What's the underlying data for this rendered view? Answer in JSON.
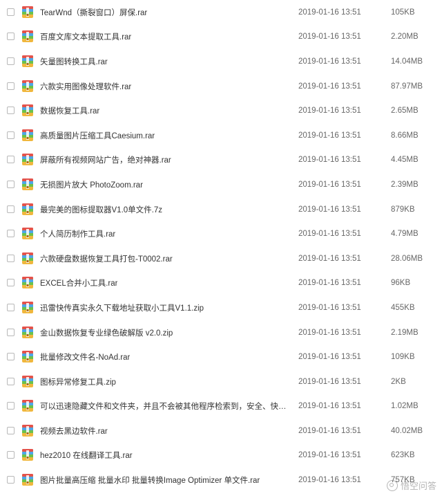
{
  "files": [
    {
      "name": "TearWnd（撕裂窗口）屏保.rar",
      "date": "2019-01-16 13:51",
      "size": "105KB"
    },
    {
      "name": "百度文库文本提取工具.rar",
      "date": "2019-01-16 13:51",
      "size": "2.20MB"
    },
    {
      "name": "矢量图转换工具.rar",
      "date": "2019-01-16 13:51",
      "size": "14.04MB"
    },
    {
      "name": "六款实用图像处理软件.rar",
      "date": "2019-01-16 13:51",
      "size": "87.97MB"
    },
    {
      "name": "数据恢复工具.rar",
      "date": "2019-01-16 13:51",
      "size": "2.65MB"
    },
    {
      "name": "高质量图片压缩工具Caesium.rar",
      "date": "2019-01-16 13:51",
      "size": "8.66MB"
    },
    {
      "name": "屏蔽所有视频网站广告，绝对神器.rar",
      "date": "2019-01-16 13:51",
      "size": "4.45MB"
    },
    {
      "name": "无损图片放大 PhotoZoom.rar",
      "date": "2019-01-16 13:51",
      "size": "2.39MB"
    },
    {
      "name": "最完美的图标提取器V1.0单文件.7z",
      "date": "2019-01-16 13:51",
      "size": "879KB"
    },
    {
      "name": "个人简历制作工具.rar",
      "date": "2019-01-16 13:51",
      "size": "4.79MB"
    },
    {
      "name": "六款硬盘数据恢复工具打包-T0002.rar",
      "date": "2019-01-16 13:51",
      "size": "28.06MB"
    },
    {
      "name": "EXCEL合并小工具.rar",
      "date": "2019-01-16 13:51",
      "size": "96KB"
    },
    {
      "name": "迅雷快传真实永久下载地址获取小工具V1.1.zip",
      "date": "2019-01-16 13:51",
      "size": "455KB"
    },
    {
      "name": "金山数据恢复专业绿色破解版 v2.0.zip",
      "date": "2019-01-16 13:51",
      "size": "2.19MB"
    },
    {
      "name": "批量修改文件名-NoAd.rar",
      "date": "2019-01-16 13:51",
      "size": "109KB"
    },
    {
      "name": "图标异常修复工具.zip",
      "date": "2019-01-16 13:51",
      "size": "2KB"
    },
    {
      "name": "可以迅速隐藏文件和文件夹，并且不会被其他程序检索到，安全、快速 Wi...",
      "date": "2019-01-16 13:51",
      "size": "1.02MB"
    },
    {
      "name": "视频去黑边软件.rar",
      "date": "2019-01-16 13:51",
      "size": "40.02MB"
    },
    {
      "name": "hez2010 在线翻译工具.rar",
      "date": "2019-01-16 13:51",
      "size": "623KB"
    },
    {
      "name": "图片批量高压缩 批量水印 批量转换Image Optimizer 单文件.rar",
      "date": "2019-01-16 13:51",
      "size": "757KB"
    }
  ],
  "watermark": {
    "text": "悟空问答"
  },
  "icons": {
    "file": "archive-file-icon",
    "checkbox": "checkbox"
  },
  "colors": {
    "text": "#333333",
    "meta": "#666666",
    "checkbox_border": "#b8b8b8"
  }
}
